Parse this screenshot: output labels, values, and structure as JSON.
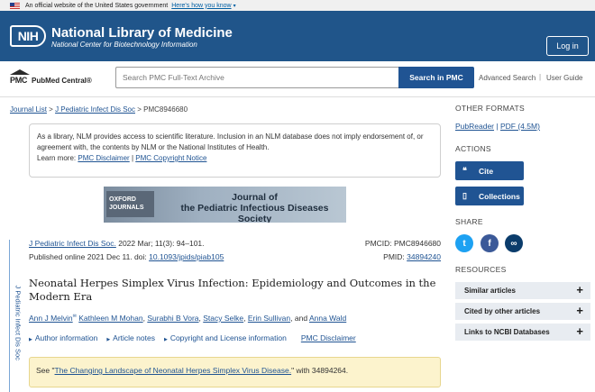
{
  "gov_banner": {
    "text": "An official website of the United States government",
    "how_link": "Here's how you know"
  },
  "header": {
    "logo": "NIH",
    "title": "National Library of Medicine",
    "subtitle": "National Center for Biotechnology Information",
    "login_label": "Log in"
  },
  "search": {
    "logo_mark": "PMC",
    "logo_name": "PubMed Central®",
    "placeholder": "Search PMC Full-Text Archive",
    "button_label": "Search in PMC",
    "advanced": "Advanced Search",
    "separator": "|",
    "guide": "User Guide"
  },
  "breadcrumb": {
    "items": [
      "Journal List",
      "J Pediatric Infect Dis Soc",
      "PMC8946680"
    ],
    "sep": ">"
  },
  "disclaimer": {
    "text": "As a library, NLM provides access to scientific literature. Inclusion in an NLM database does not imply endorsement of, or agreement with, the contents by NLM or the National Institutes of Health.",
    "learn_more": "Learn more:",
    "link1": "PMC Disclaimer",
    "sep": "|",
    "link2": "PMC Copyright Notice"
  },
  "journal_banner": {
    "publisher": "OXFORD JOURNALS",
    "journal_line1": "Journal of",
    "journal_line2": "the Pediatric Infectious Diseases Society"
  },
  "citation": {
    "journal": "J Pediatric Infect Dis Soc.",
    "details": "2022 Mar; 11(3): 94–101.",
    "published": "Published online 2021 Dec 11. doi:",
    "doi": "10.1093/jpids/piab105",
    "pmcid_label": "PMCID: PMC8946680",
    "pmid_label": "PMID:",
    "pmid": "34894240",
    "vertical_journal": "J Pediatric Infect Dis Soc"
  },
  "article": {
    "title": "Neonatal Herpes Simplex Virus Infection: Epidemiology and Outcomes in the Modern Era",
    "authors": [
      "Ann J Melvin",
      "Kathleen M Mohan",
      "Surabhi B Vora",
      "Stacy Selke",
      "Erin Sullivan",
      "Anna Wald"
    ],
    "and": "and",
    "author_sup": "✉",
    "tabs": [
      "Author information",
      "Article notes",
      "Copyright and License information"
    ],
    "disclaimer_link": "PMC Disclaimer"
  },
  "notice": {
    "prefix": "See \"",
    "link": "The Changing Landscape of Neonatal Herpes Simplex Virus Disease.",
    "suffix": "\" with 34894264."
  },
  "sidebar": {
    "other_formats_heading": "OTHER FORMATS",
    "formats": [
      "PubReader",
      "PDF (4.5M)"
    ],
    "format_sep": "|",
    "actions_heading": "ACTIONS",
    "cite_label": "Cite",
    "collections_label": "Collections",
    "share_heading": "SHARE",
    "share_icons": [
      "twitter-icon",
      "facebook-icon",
      "link-icon"
    ],
    "resources_heading": "RESOURCES",
    "resources": [
      "Similar articles",
      "Cited by other articles",
      "Links to NCBI Databases"
    ]
  },
  "colors": {
    "header_bg": "#20558a",
    "primary_button": "#205493",
    "link": "#205493",
    "notice_bg": "#fcf3cd",
    "twitter": "#1da1f2",
    "facebook": "#3b5998",
    "link_share": "#0b3c6b"
  }
}
